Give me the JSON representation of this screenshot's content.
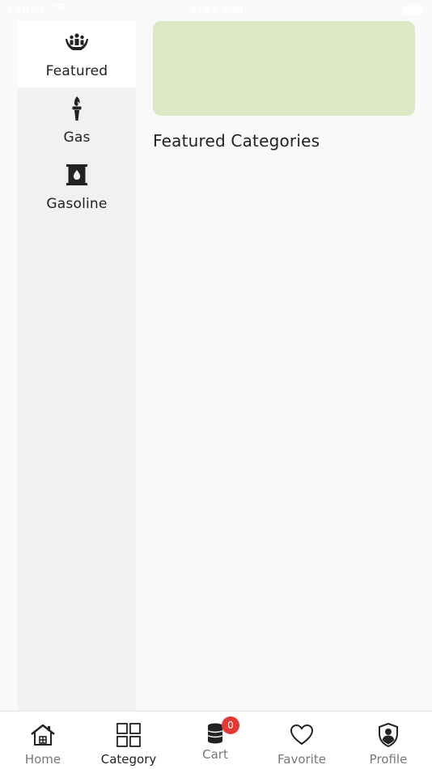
{
  "status_bar": {
    "carrier": "Carrier",
    "time": "4:47 PM"
  },
  "sidebar": {
    "items": [
      {
        "label": "Featured",
        "icon": "people-hands-icon",
        "active": true
      },
      {
        "label": "Gas",
        "icon": "torch-icon",
        "active": false
      },
      {
        "label": "Gasoline",
        "icon": "oil-barrel-icon",
        "active": false
      }
    ]
  },
  "main": {
    "section_title": "Featured Categories",
    "banner_color": "#dce8c3"
  },
  "bottom_nav": {
    "items": [
      {
        "label": "Home",
        "icon": "home-icon"
      },
      {
        "label": "Category",
        "icon": "grid-icon",
        "active": true
      },
      {
        "label": "Cart",
        "icon": "cart-barrel-icon",
        "badge": "0"
      },
      {
        "label": "Favorite",
        "icon": "heart-icon"
      },
      {
        "label": "Profile",
        "icon": "shield-user-icon"
      }
    ]
  }
}
